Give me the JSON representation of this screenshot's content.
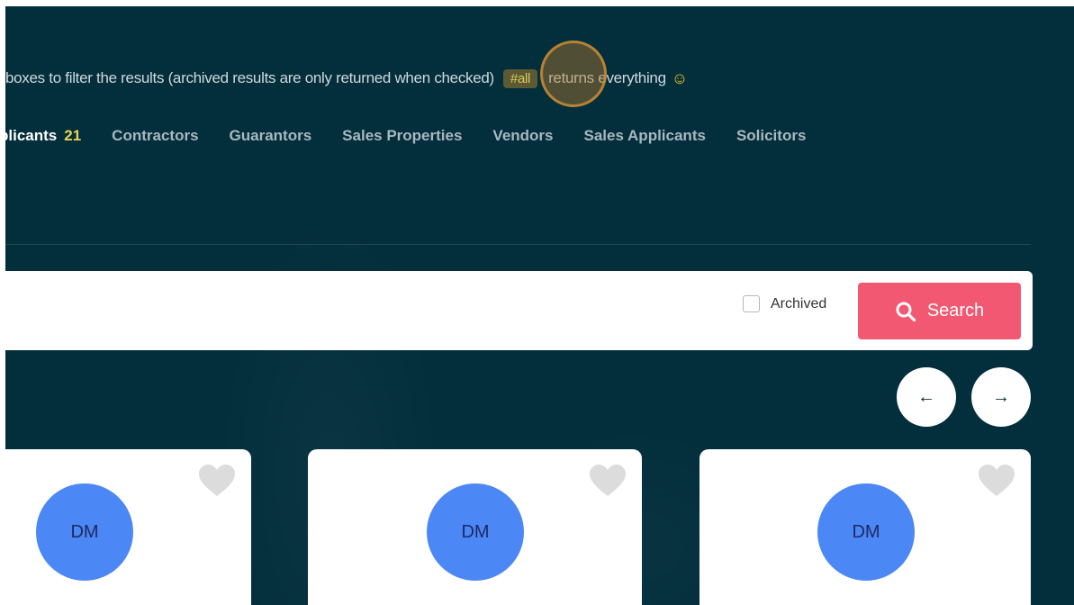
{
  "hint": {
    "text_before": "boxes to filter the results (archived results are only returned when checked)",
    "tag": "#all",
    "text_after": "returns everything",
    "emoji": "☺"
  },
  "tabs": [
    {
      "label": "plicants",
      "count": "21",
      "active": true
    },
    {
      "label": "Contractors"
    },
    {
      "label": "Guarantors"
    },
    {
      "label": "Sales Properties"
    },
    {
      "label": "Vendors"
    },
    {
      "label": "Sales Applicants"
    },
    {
      "label": "Solicitors"
    }
  ],
  "search": {
    "archived_label": "Archived",
    "archived_checked": false,
    "button_label": "Search"
  },
  "pager": {
    "prev_icon": "arrow-left-icon",
    "next_icon": "arrow-right-icon",
    "prev_glyph": "←",
    "next_glyph": "→"
  },
  "cards": [
    {
      "initials": "DM",
      "favourite_icon": "heart-icon"
    },
    {
      "initials": "DM",
      "favourite_icon": "heart-icon"
    },
    {
      "initials": "DM",
      "favourite_icon": "heart-icon"
    }
  ],
  "colors": {
    "background": "#032e3c",
    "accent": "#f35872",
    "avatar": "#4b87f5",
    "tab_count": "#e9d34f"
  }
}
